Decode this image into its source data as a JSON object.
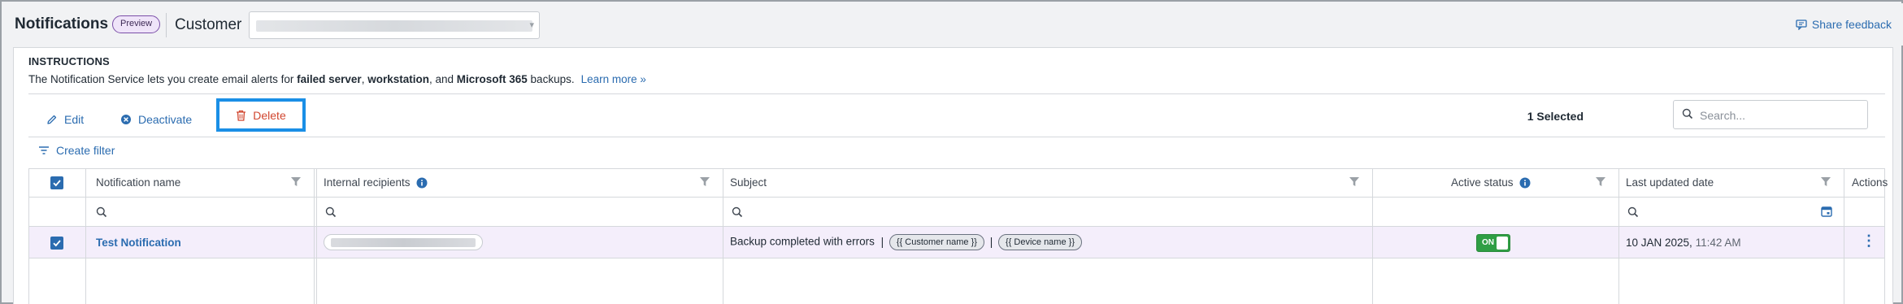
{
  "header": {
    "title": "Notifications",
    "badge": "Preview",
    "customer_label": "Customer",
    "feedback": "Share feedback"
  },
  "instructions": {
    "title": "INSTRUCTIONS",
    "text_prefix": "The Notification Service lets you create email alerts for ",
    "bold1": "failed server",
    "sep1": ", ",
    "bold2": "workstation",
    "sep2": ", and ",
    "bold3": "Microsoft 365",
    "text_suffix": " backups.",
    "learn_more": "Learn more »"
  },
  "toolbar": {
    "edit": "Edit",
    "deactivate": "Deactivate",
    "delete": "Delete",
    "selected": "1 Selected",
    "search_placeholder": "Search..."
  },
  "filter": {
    "create_filter": "Create filter"
  },
  "table": {
    "columns": {
      "name": "Notification name",
      "recipients": "Internal recipients",
      "subject": "Subject",
      "status": "Active status",
      "updated": "Last updated date",
      "actions": "Actions"
    },
    "rows": [
      {
        "name": "Test Notification",
        "subject_text": "Backup completed with errors",
        "token1": "{{ Customer name }}",
        "token2": "{{ Device name }}",
        "status": "ON",
        "date": "10 JAN 2025,",
        "time": "11:42 AM"
      }
    ]
  },
  "colors": {
    "accent": "#2b6cb0",
    "delete": "#d1462f",
    "highlight_border": "#1a8fe6",
    "row_selected": "#f4eefb",
    "toggle_on": "#2f9e44"
  }
}
